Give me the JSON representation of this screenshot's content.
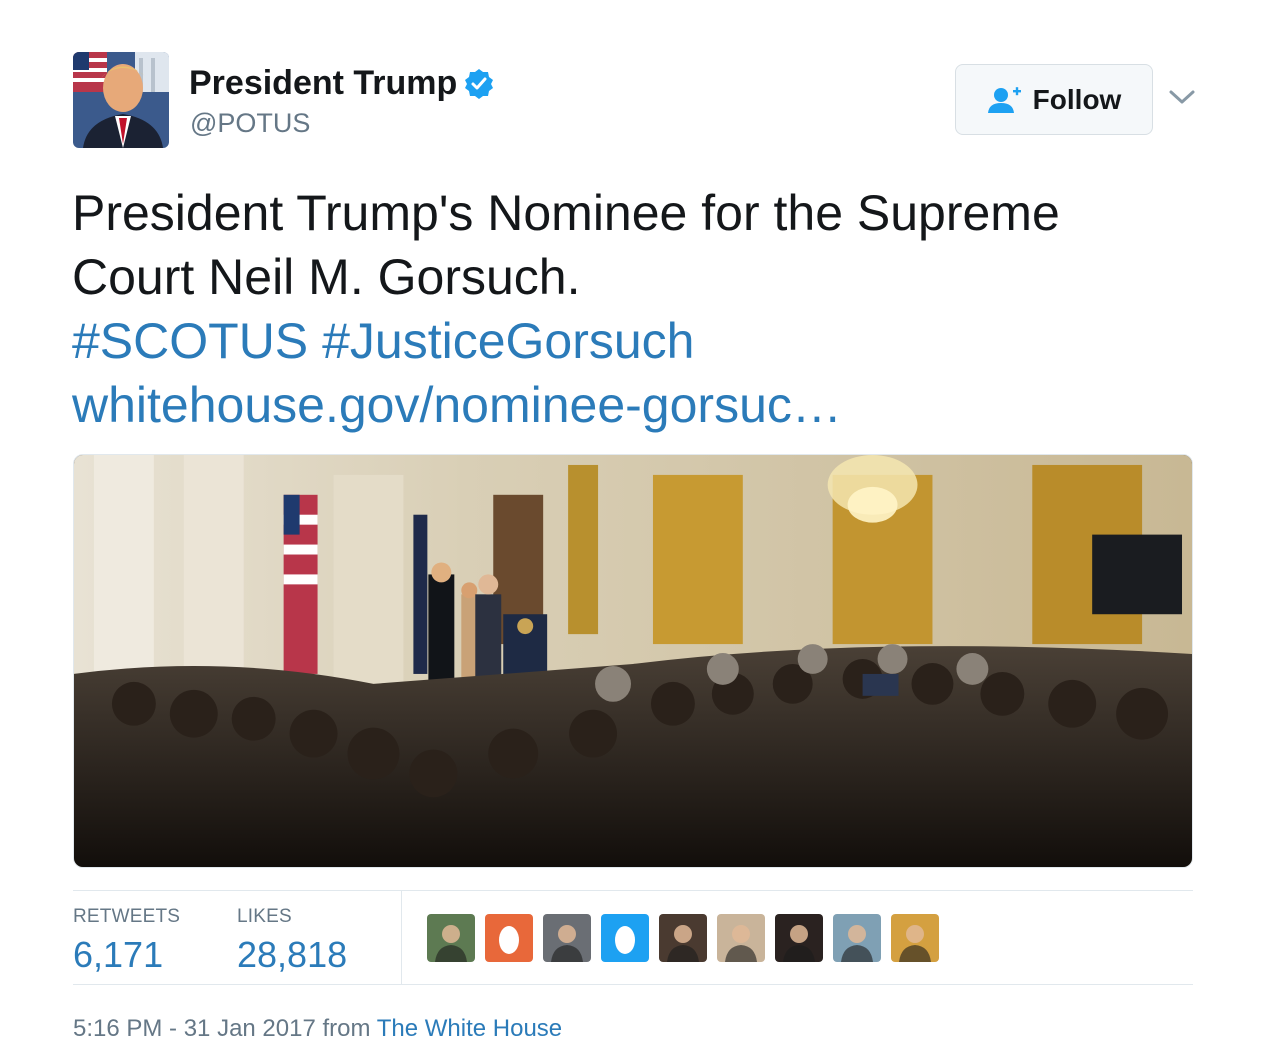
{
  "author": {
    "display_name": "President Trump",
    "handle": "@POTUS",
    "verified_icon": "verified-badge-icon",
    "avatar_icon": "profile-photo"
  },
  "follow_button": {
    "label": "Follow",
    "icon": "add-user-icon"
  },
  "menu": {
    "icon": "chevron-down-icon"
  },
  "tweet": {
    "text_line": "President Trump's Nominee for the Supreme Court Neil M. Gorsuch.",
    "hashtag_1": "#SCOTUS",
    "hashtag_2": "#JusticeGorsuch",
    "link": "whitehouse.gov/nominee-gorsuc…"
  },
  "media": {
    "type": "photo"
  },
  "stats": {
    "retweets_label": "RETWEETS",
    "retweets_value": "6,171",
    "likes_label": "LIKES",
    "likes_value": "28,818"
  },
  "likers": [
    {
      "icon": "avatar-photo",
      "color": "#5d7a52"
    },
    {
      "icon": "default-egg-avatar",
      "color": "#e8683a"
    },
    {
      "icon": "avatar-photo",
      "color": "#6a6e74"
    },
    {
      "icon": "default-egg-avatar",
      "color": "#1da1f2"
    },
    {
      "icon": "avatar-photo",
      "color": "#4a3a30"
    },
    {
      "icon": "avatar-photo",
      "color": "#c9b49a"
    },
    {
      "icon": "avatar-photo",
      "color": "#2a2220"
    },
    {
      "icon": "avatar-photo",
      "color": "#7fa0b4"
    },
    {
      "icon": "avatar-photo",
      "color": "#d4a040"
    }
  ],
  "meta": {
    "timestamp": "5:16 PM - 31 Jan 2017",
    "from_label": " from ",
    "source": "The White House"
  },
  "colors": {
    "link": "#2b7bb9",
    "muted": "#657786",
    "verified": "#1da1f2",
    "text": "#14171a"
  }
}
